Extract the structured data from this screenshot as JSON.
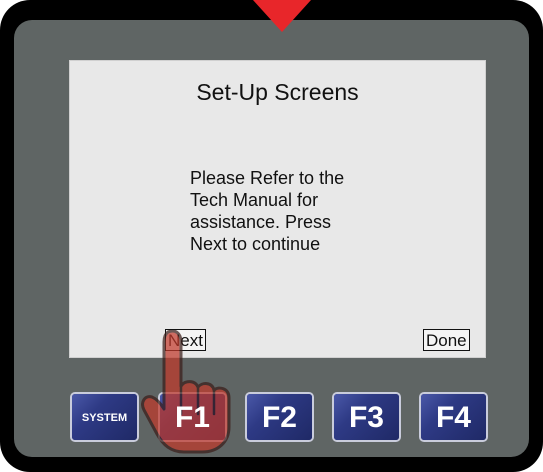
{
  "screen": {
    "title": "Set-Up Screens",
    "message_lines": [
      "Please Refer to the",
      "Tech Manual for",
      "assistance.  Press",
      "Next to continue"
    ],
    "next_label": "Next",
    "done_label": "Done"
  },
  "function_keys": {
    "system_label": "SYSTEM",
    "f1_label": "F1",
    "f2_label": "F2",
    "f3_label": "F3",
    "f4_label": "F4"
  },
  "colors": {
    "bezel": "#000000",
    "panel": "#5f6564",
    "screen": "#e8e8e8",
    "key_blue": "#2e3a85",
    "arrow_red": "#e8262a",
    "hand_red": "#c0392b"
  },
  "icons": {
    "top_indicator": "down-arrow-icon",
    "pointer": "hand-pointer-icon"
  }
}
